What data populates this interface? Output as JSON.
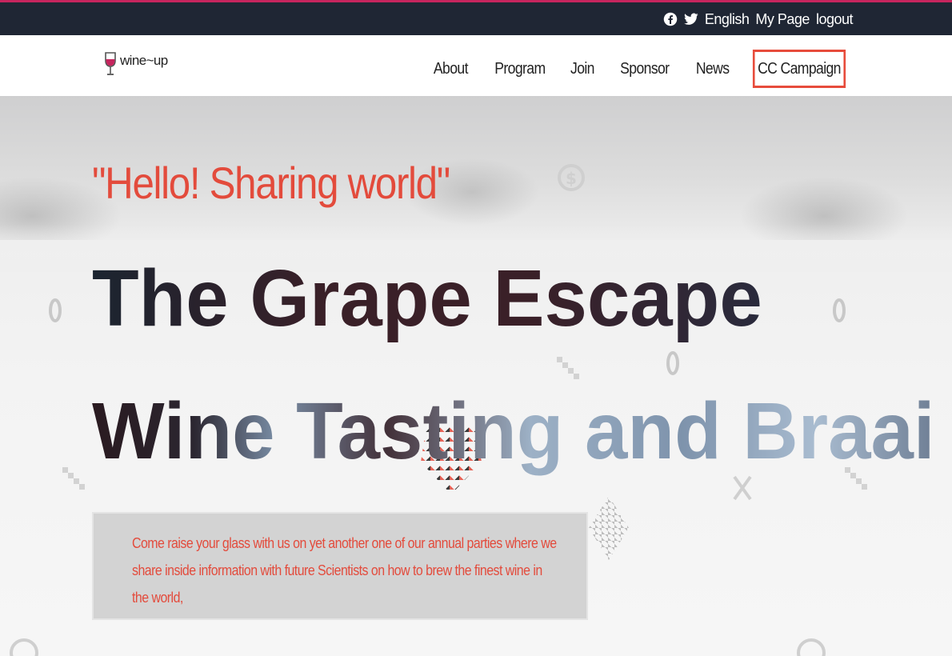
{
  "topbar": {
    "language": "English",
    "my_page": "My Page",
    "logout": "logout",
    "accent_color": "#c6255e",
    "background_color": "#1f2634"
  },
  "logo": {
    "text": "wine~up",
    "icon": "wine-glass-icon"
  },
  "nav": {
    "items": [
      {
        "label": "About"
      },
      {
        "label": "Program"
      },
      {
        "label": "Join"
      },
      {
        "label": "Sponsor"
      },
      {
        "label": "News"
      },
      {
        "label": "CC Campaign",
        "highlighted": true
      }
    ],
    "highlight_color": "#e74c3c"
  },
  "hero": {
    "tagline": "\"Hello! Sharing world\"",
    "title_line1": "The Grape Escape",
    "title_line2": "Wine Tasting and Braai",
    "intro": "Come raise your glass with us on yet another one of our annual parties where we share inside information with future Scientists on how to brew the finest wine in the world,",
    "accent_color": "#e34b3c"
  }
}
